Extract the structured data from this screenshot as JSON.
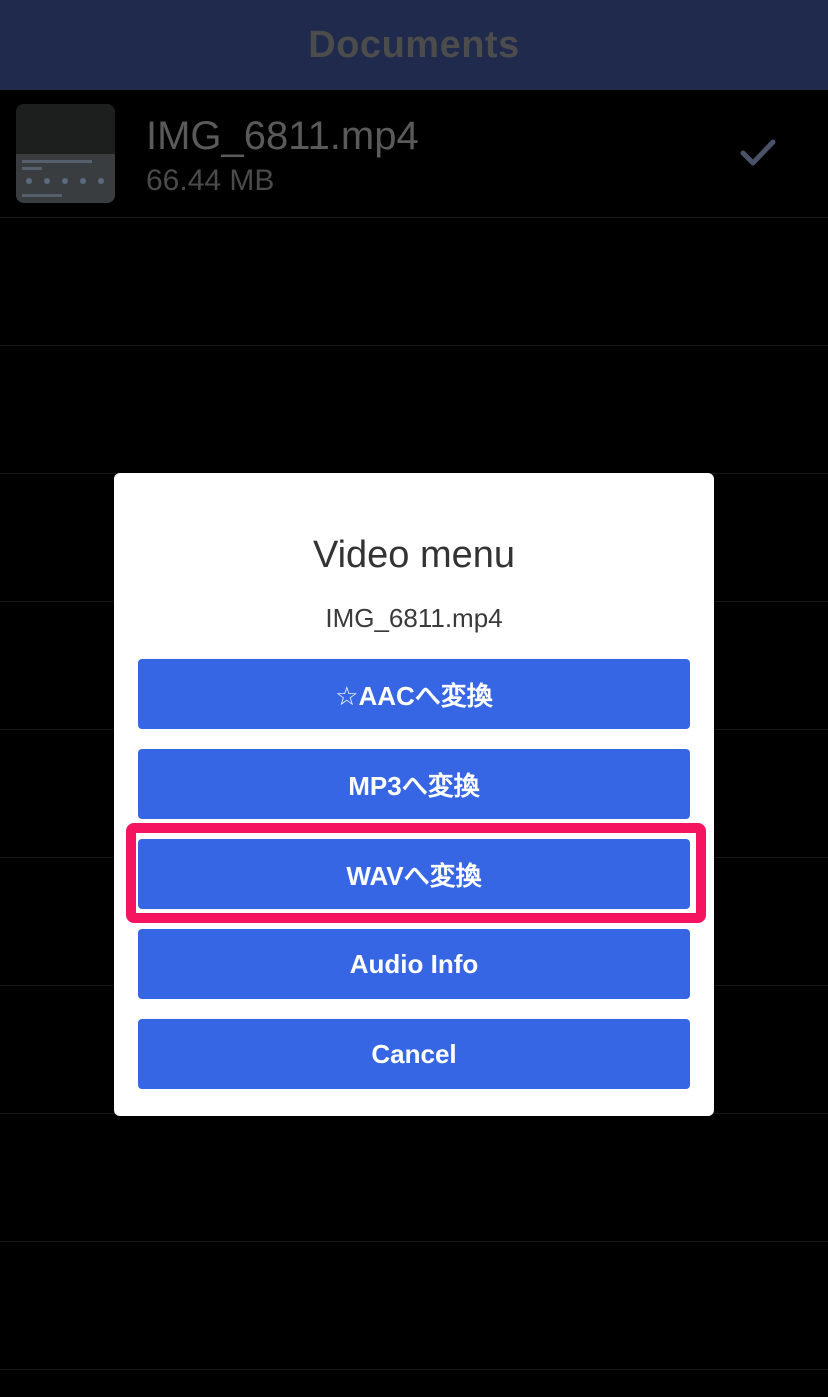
{
  "header": {
    "title": "Documents"
  },
  "files": [
    {
      "name": "IMG_6811.mp4",
      "size": "66.44 MB",
      "thumbnail_icon": "video-thumbnail",
      "status_icon": "checkmark-icon"
    }
  ],
  "dialog": {
    "title": "Video menu",
    "subtitle": "IMG_6811.mp4",
    "buttons": [
      {
        "label": "☆AACへ変換"
      },
      {
        "label": "MP3へ変換"
      },
      {
        "label": "WAVへ変換",
        "highlighted": true
      },
      {
        "label": "Audio Info"
      },
      {
        "label": "Cancel"
      }
    ]
  },
  "colors": {
    "navbar_bg": "#202a4c",
    "button_bg": "#3666e3",
    "highlight_border": "#f4145f",
    "dialog_bg": "#ffffff",
    "page_bg": "#000000"
  }
}
